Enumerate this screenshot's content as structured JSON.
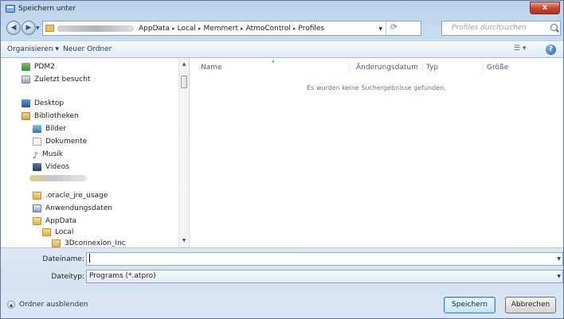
{
  "window": {
    "title": "Speichern unter",
    "close_label": "x"
  },
  "address": {
    "crumbs": [
      "AppData",
      "Local",
      "Memmert",
      "AtmoControl",
      "Profiles"
    ],
    "separator": "▸",
    "search_placeholder": "Profiles durchsuchen"
  },
  "toolbar": {
    "organize_label": "Organisieren ▾",
    "new_folder_label": "Neuer Ordner"
  },
  "nav": {
    "items": [
      {
        "label": "PDM2",
        "icon": "pdm-icon"
      },
      {
        "label": "Zuletzt besucht",
        "icon": "recent-icon"
      },
      {
        "label": "Desktop",
        "icon": "desktop-icon"
      },
      {
        "label": "Bibliotheken",
        "icon": "libraries-icon"
      },
      {
        "label": "Bilder",
        "icon": "pictures-icon"
      },
      {
        "label": "Dokumente",
        "icon": "documents-icon"
      },
      {
        "label": "Musik",
        "icon": "music-icon"
      },
      {
        "label": "Videos",
        "icon": "videos-icon"
      },
      {
        "label": ".oracle_jre_usage",
        "icon": "folder-icon"
      },
      {
        "label": "Anwendungsdaten",
        "icon": "shortcut-folder-icon"
      },
      {
        "label": "AppData",
        "icon": "folder-icon"
      },
      {
        "label": "Local",
        "icon": "folder-icon"
      },
      {
        "label": "3Dconnexion_Inc",
        "icon": "folder-icon"
      }
    ]
  },
  "filelist": {
    "columns": [
      "Name",
      "Änderungsdatum",
      "Typ",
      "Größe"
    ],
    "empty_message": "Es wurden keine Suchergebnisse gefunden."
  },
  "form": {
    "filename_label": "Dateiname:",
    "filename_value": "",
    "filetype_label": "Dateityp:",
    "filetype_value": "Programs (*.atpro)"
  },
  "footer": {
    "hide_folders_label": "Ordner ausblenden",
    "save_label": "Speichern",
    "cancel_label": "Abbrechen"
  }
}
